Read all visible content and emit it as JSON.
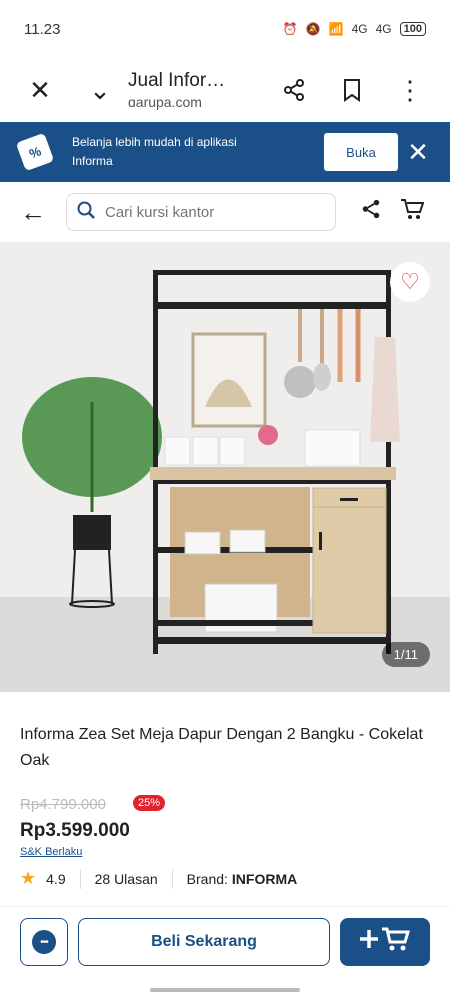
{
  "status": {
    "time": "11.23",
    "signal1": "4G",
    "signal2": "4G",
    "battery": "100"
  },
  "browser": {
    "title": "Jual Infor…",
    "domain": "ɑarupa.com"
  },
  "banner": {
    "text_line1": "Belanja lebih mudah di aplikasi",
    "text_line2": "Informa",
    "button_label": "Buka"
  },
  "search": {
    "placeholder": "Cari kursi kantor"
  },
  "gallery": {
    "counter": "1/11"
  },
  "product": {
    "title": "Informa Zea Set Meja Dapur Dengan 2 Bangku - Cokelat Oak",
    "original_price": "Rp4.799.000",
    "discount": "25%",
    "price": "Rp3.599.000",
    "terms": "S&K Berlaku",
    "rating": "4.9",
    "reviews": "28 Ulasan",
    "brand_label": "Brand:",
    "brand": "INFORMA"
  },
  "actions": {
    "buy_label": "Beli Sekarang",
    "chat_icon_text": "•••"
  },
  "colors": {
    "primary": "#1a4f88",
    "discount": "#e0232d",
    "star": "#f5a623"
  }
}
